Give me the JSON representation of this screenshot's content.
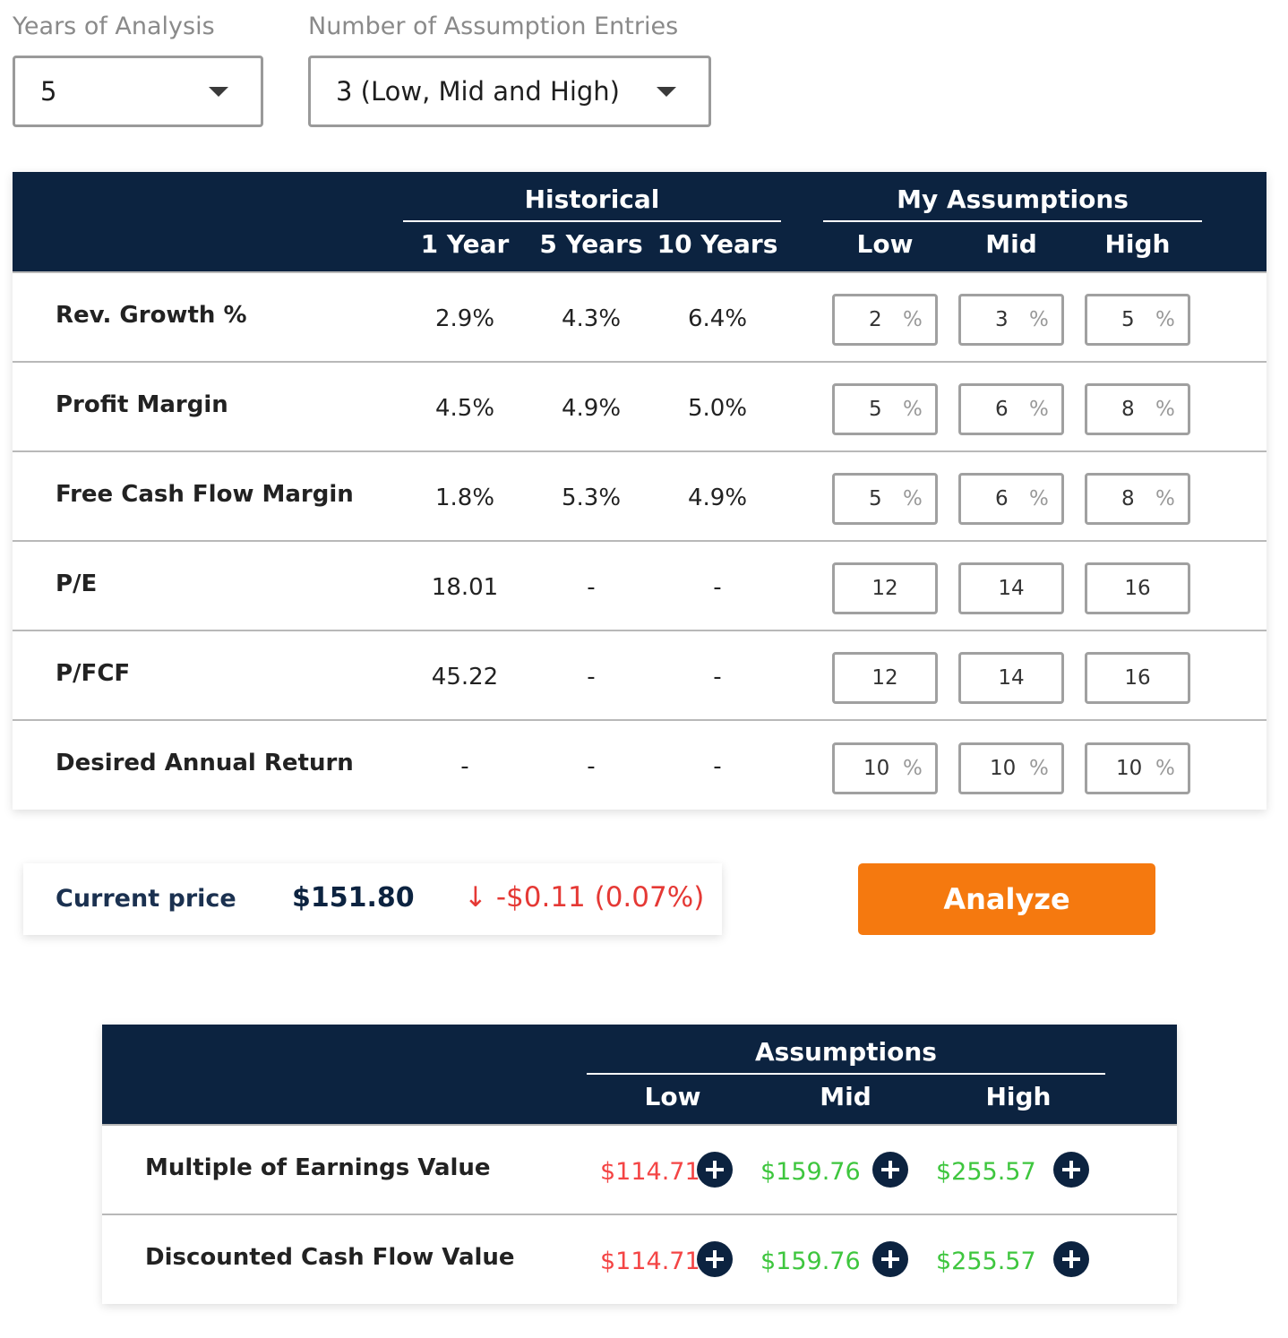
{
  "controls": {
    "years_label": "Years of Analysis",
    "years_value": "5",
    "entries_label": "Number of Assumption Entries",
    "entries_value": "3 (Low, Mid and High)"
  },
  "assumptions_table": {
    "group_historical": "Historical",
    "group_mine": "My Assumptions",
    "columns": [
      "1 Year",
      "5 Years",
      "10 Years",
      "Low",
      "Mid",
      "High"
    ],
    "rows": [
      {
        "label": "Rev. Growth %",
        "hist": [
          "2.9%",
          "4.3%",
          "6.4%"
        ],
        "inputs": [
          "2",
          "3",
          "5"
        ],
        "unit": "%"
      },
      {
        "label": "Profit Margin",
        "hist": [
          "4.5%",
          "4.9%",
          "5.0%"
        ],
        "inputs": [
          "5",
          "6",
          "8"
        ],
        "unit": "%"
      },
      {
        "label": "Free Cash Flow Margin",
        "hist": [
          "1.8%",
          "5.3%",
          "4.9%"
        ],
        "inputs": [
          "5",
          "6",
          "8"
        ],
        "unit": "%"
      },
      {
        "label": "P/E",
        "hist": [
          "18.01",
          "-",
          "-"
        ],
        "inputs": [
          "12",
          "14",
          "16"
        ],
        "unit": ""
      },
      {
        "label": "P/FCF",
        "hist": [
          "45.22",
          "-",
          "-"
        ],
        "inputs": [
          "12",
          "14",
          "16"
        ],
        "unit": ""
      },
      {
        "label": "Desired Annual Return",
        "hist": [
          "-",
          "-",
          "-"
        ],
        "inputs": [
          "10",
          "10",
          "10"
        ],
        "unit": "%"
      }
    ]
  },
  "price": {
    "label": "Current price",
    "value": "$151.80",
    "change": "↓ -$0.11 (0.07%)",
    "change_color": "#e53935"
  },
  "analyze_label": "Analyze",
  "results_table": {
    "group": "Assumptions",
    "columns": [
      "Low",
      "Mid",
      "High"
    ],
    "rows": [
      {
        "label": "Multiple of Earnings Value",
        "values": [
          "$114.71",
          "$159.76",
          "$255.57"
        ]
      },
      {
        "label": "Discounted Cash Flow Value",
        "values": [
          "$114.71",
          "$159.76",
          "$255.57"
        ]
      }
    ],
    "value_colors": [
      "#f44545",
      "#3ec63e",
      "#3ec63e"
    ]
  },
  "colors": {
    "header_bg": "#0c2340",
    "accent": "#f5790f"
  },
  "icons": {
    "dropdown": "chevron-down-icon",
    "expand": "plus-circle-icon",
    "change_direction": "arrow-down-icon"
  }
}
